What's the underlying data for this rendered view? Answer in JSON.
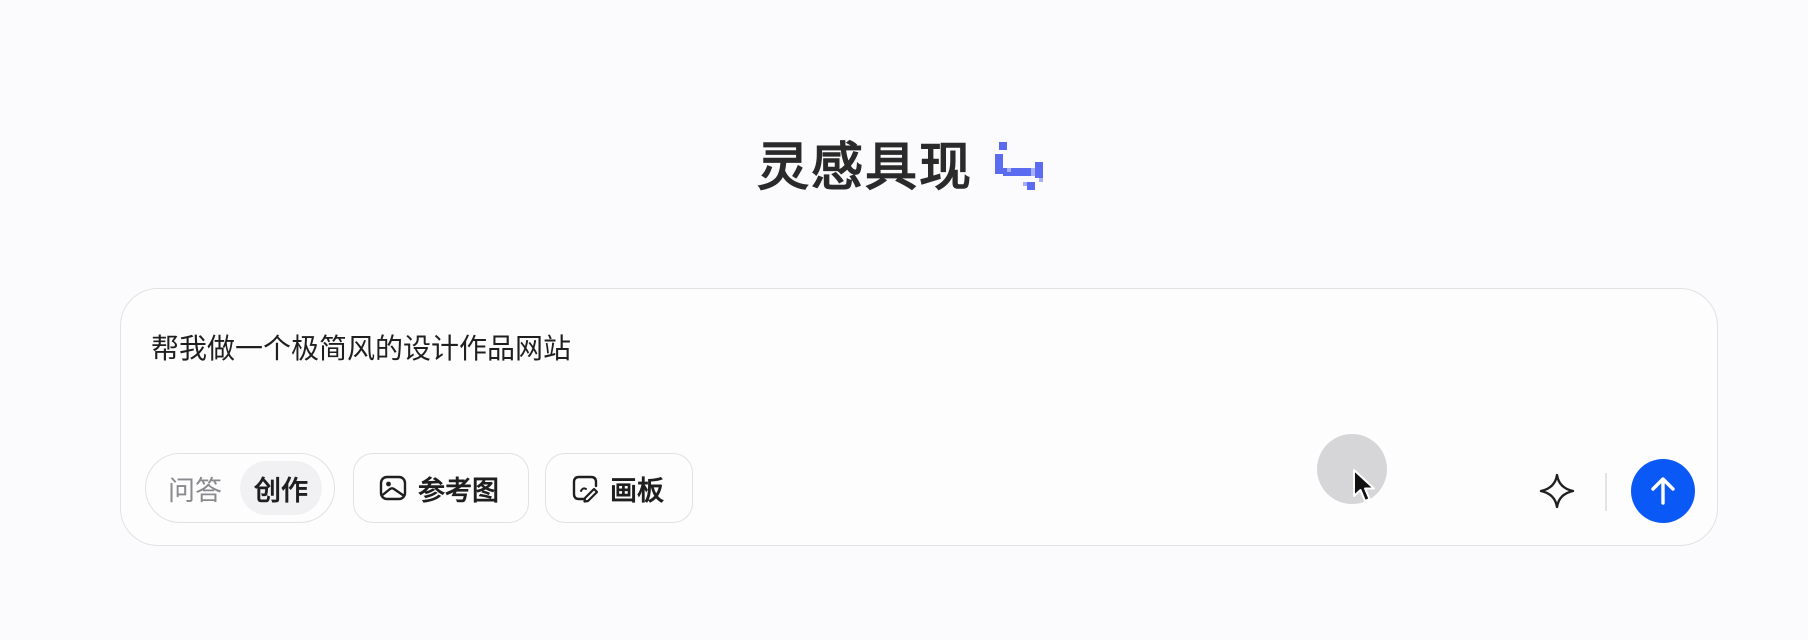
{
  "header": {
    "title": "灵感具现",
    "logo_icon": "pixel-logo-icon",
    "logo_color": "#5b6cf0"
  },
  "composer": {
    "prompt_value": "帮我做一个极简风的设计作品网站",
    "mode_toggle": {
      "options": [
        "问答",
        "创作"
      ],
      "selected": "创作"
    },
    "tools": {
      "reference_image_label": "参考图",
      "reference_image_icon": "image-icon",
      "canvas_label": "画板",
      "canvas_icon": "canvas-pen-icon"
    },
    "actions": {
      "sparkle_icon": "sparkle-icon",
      "send_icon": "arrow-up-icon",
      "send_color": "#0a59f7"
    }
  },
  "overlay": {
    "cursor_icon": "mouse-pointer-icon"
  }
}
